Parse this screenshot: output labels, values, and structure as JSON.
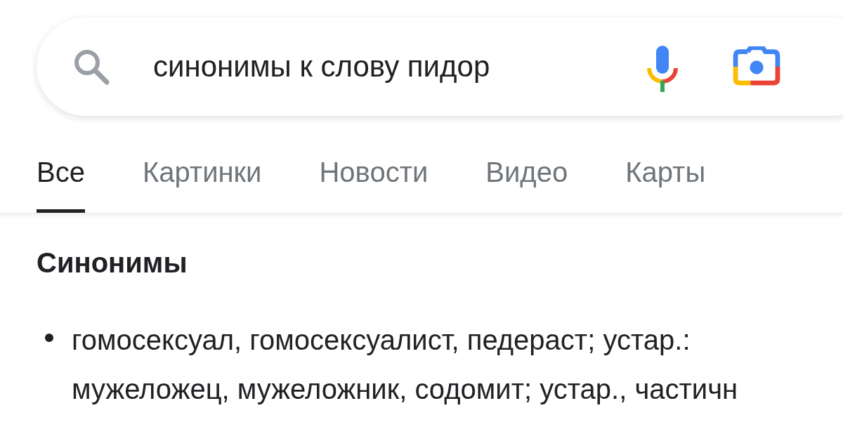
{
  "search": {
    "value": "синонимы к слову пидор"
  },
  "tabs": [
    {
      "label": "Все",
      "selected": true
    },
    {
      "label": "Картинки",
      "selected": false
    },
    {
      "label": "Новости",
      "selected": false
    },
    {
      "label": "Видео",
      "selected": false
    },
    {
      "label": "Карты",
      "selected": false
    }
  ],
  "synonyms": {
    "title": "Синонимы",
    "items": [
      {
        "lines": [
          "гомосексуал, гомосексуалист, педераст; устар.:",
          "мужеложец, мужеложник, содомит; устар., частичн"
        ]
      }
    ]
  }
}
